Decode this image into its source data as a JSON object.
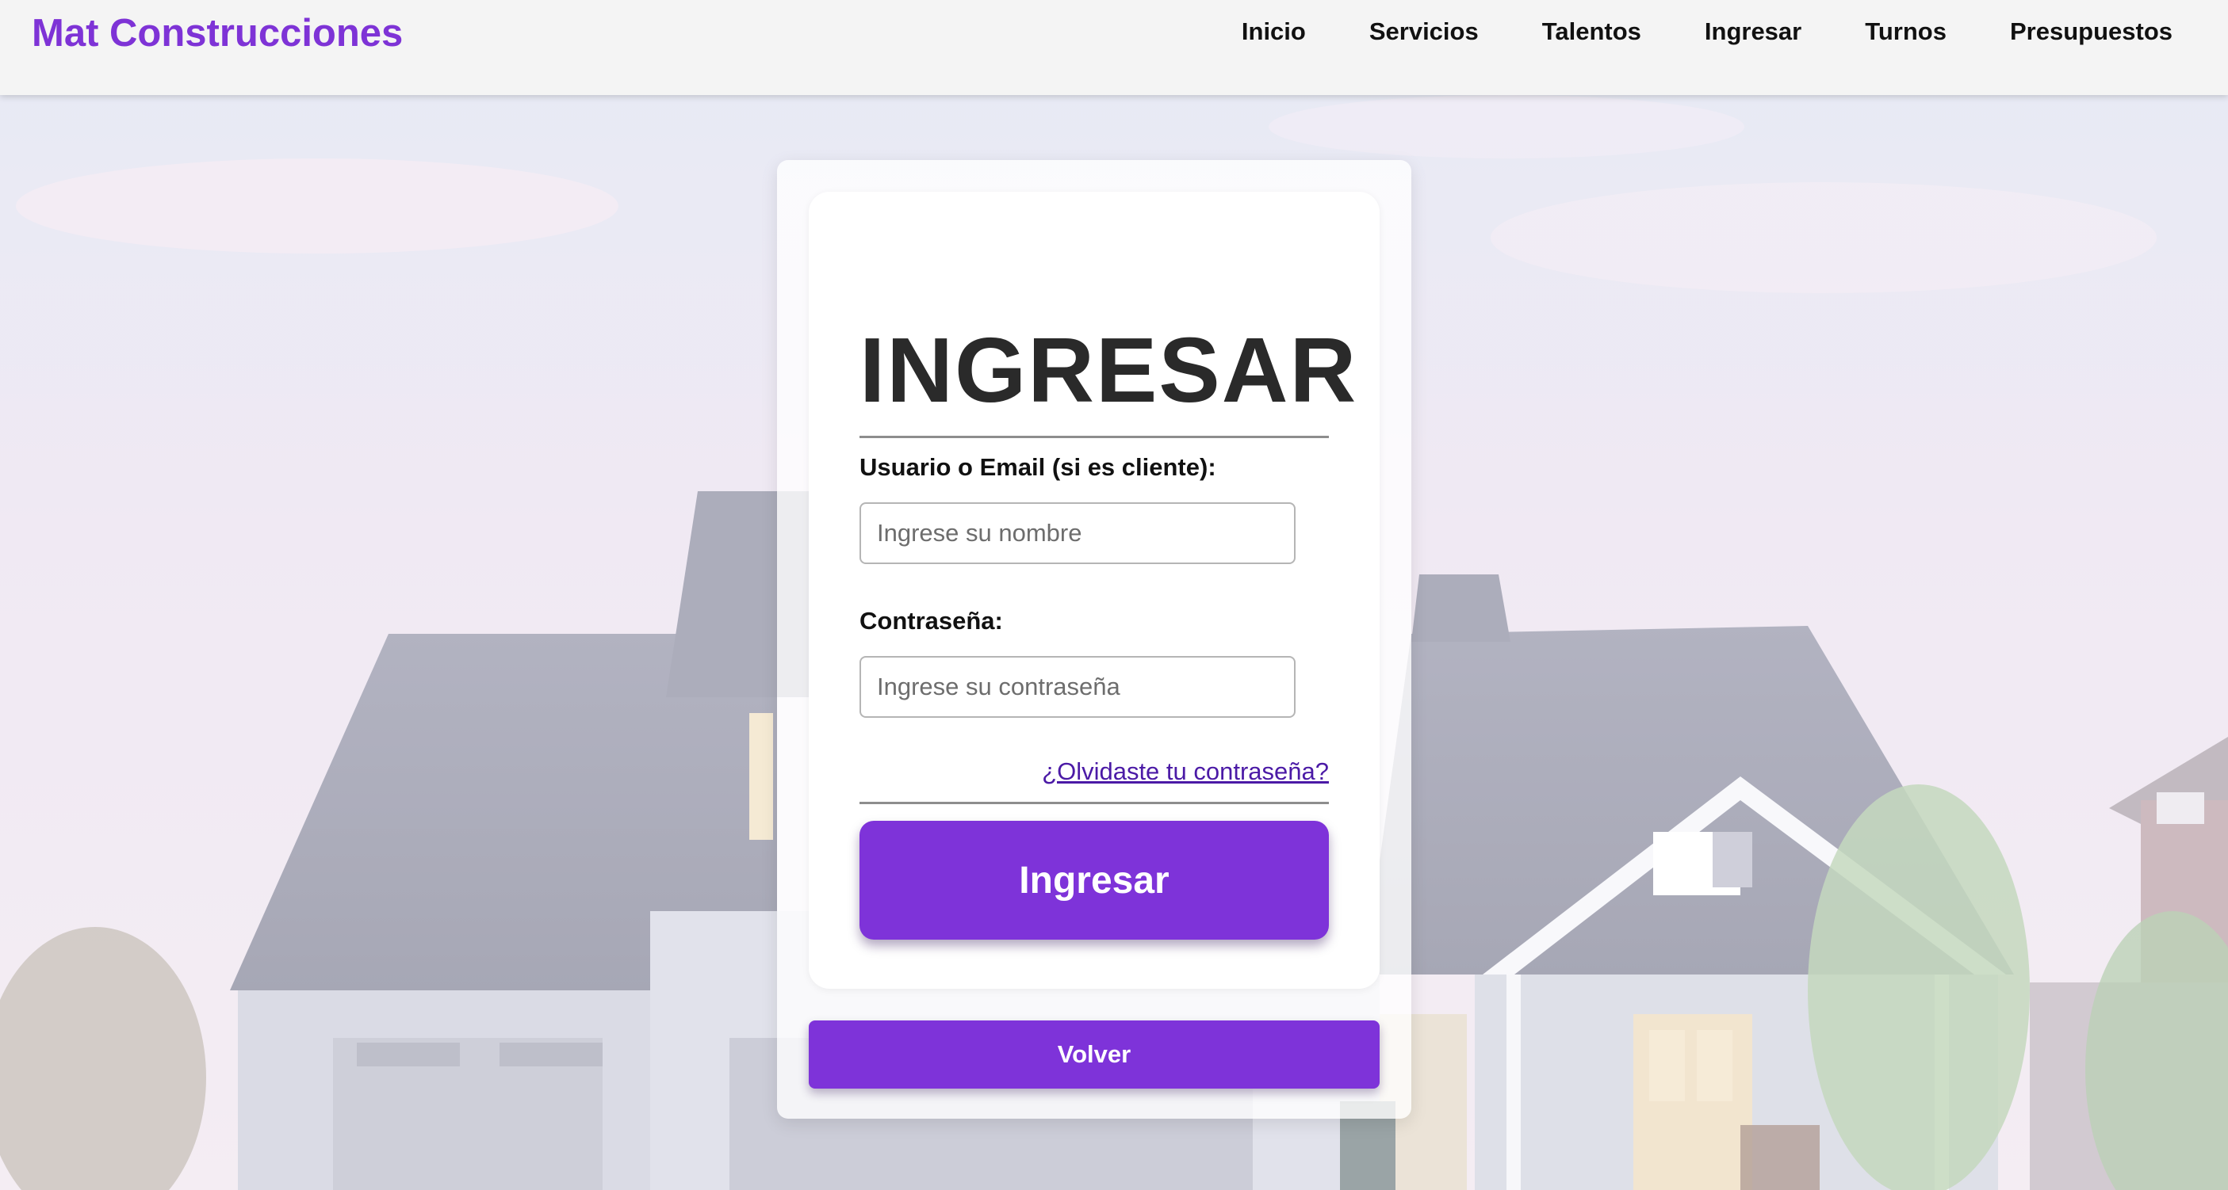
{
  "header": {
    "brand": "Mat Construcciones",
    "nav": [
      "Inicio",
      "Servicios",
      "Talentos",
      "Ingresar",
      "Turnos",
      "Presupuestos"
    ]
  },
  "login": {
    "title": "INGRESAR",
    "user_label": "Usuario o Email (si es cliente):",
    "user_placeholder": "Ingrese su nombre",
    "user_value": "",
    "password_label": "Contraseña:",
    "password_placeholder": "Ingrese su contraseña",
    "password_value": "",
    "forgot_link": "¿Olvidaste tu contraseña?",
    "submit_label": "Ingresar",
    "back_label": "Volver"
  },
  "colors": {
    "brand": "#7e33d6",
    "button": "#7e33d9",
    "link": "#4b1aa6",
    "header_bg": "#f4f4f4"
  }
}
